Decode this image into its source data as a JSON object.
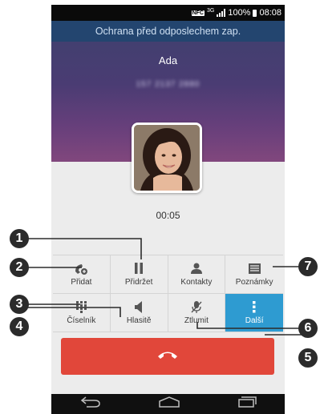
{
  "status_bar": {
    "nfc": "NFC",
    "network": "3G",
    "battery_percent": "100%",
    "time": "08:08"
  },
  "banner": "Ochrana před odposlechem zap.",
  "caller": {
    "name": "Ada",
    "number": "157 2137 2880"
  },
  "call_timer": "00:05",
  "buttons": [
    {
      "label": "Přidat",
      "icon": "add-call-icon"
    },
    {
      "label": "Přidržet",
      "icon": "pause-icon"
    },
    {
      "label": "Kontakty",
      "icon": "contact-icon"
    },
    {
      "label": "Poznámky",
      "icon": "notes-icon"
    },
    {
      "label": "Číselník",
      "icon": "dialpad-icon"
    },
    {
      "label": "Hlasitě",
      "icon": "speaker-icon"
    },
    {
      "label": "Ztlumit",
      "icon": "mute-mic-icon"
    },
    {
      "label": "Další",
      "icon": "more-icon",
      "active": true
    }
  ],
  "end_call": {
    "icon": "hang-up-icon",
    "color": "#e1473a"
  },
  "navbar": [
    "back-icon",
    "home-icon",
    "recent-apps-icon"
  ],
  "callouts": [
    "1",
    "2",
    "3",
    "4",
    "5",
    "6",
    "7"
  ],
  "colors": {
    "banner": "#23456f",
    "active_button": "#2e9bd1",
    "end_call": "#e1473a"
  }
}
